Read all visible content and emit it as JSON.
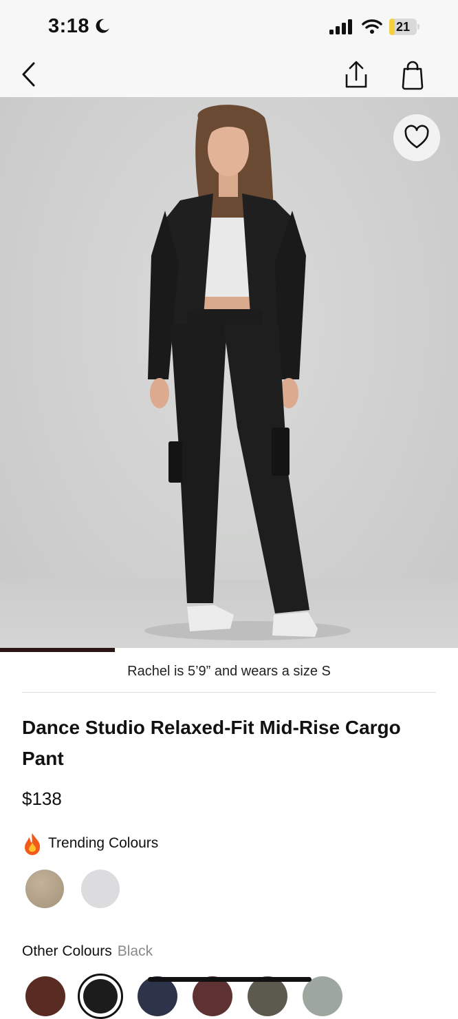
{
  "status_bar": {
    "time": "3:18",
    "battery": "21",
    "battery_level": 0.21,
    "battery_color": "#f4d03f"
  },
  "nav": {
    "icons": [
      "chevron-left-icon",
      "share-icon",
      "shopping-bag-icon"
    ]
  },
  "hero": {
    "favorite_icon": "heart-outline-icon",
    "carousel_progress": 0.25
  },
  "fit_caption": "Rachel is 5’9” and wears a size S",
  "product": {
    "title": "Dance Studio Relaxed-Fit Mid-Rise Cargo Pant",
    "price": "$138"
  },
  "trending": {
    "icon": "fire-icon",
    "label": "Trending Colours",
    "swatches": [
      {
        "name": "tan",
        "color": "#b3a48a"
      },
      {
        "name": "light-grey",
        "color": "#dcdcde"
      }
    ]
  },
  "other_colours": {
    "label": "Other Colours",
    "selected": "Black",
    "swatches": [
      {
        "name": "brown",
        "color": "#5a2b22"
      },
      {
        "name": "black",
        "color": "#1c1c1c",
        "selected": true
      },
      {
        "name": "navy",
        "color": "#2d3348"
      },
      {
        "name": "burgundy",
        "color": "#5e3232"
      },
      {
        "name": "olive",
        "color": "#5c5a4e"
      },
      {
        "name": "sage",
        "color": "#9ea79f"
      }
    ]
  }
}
